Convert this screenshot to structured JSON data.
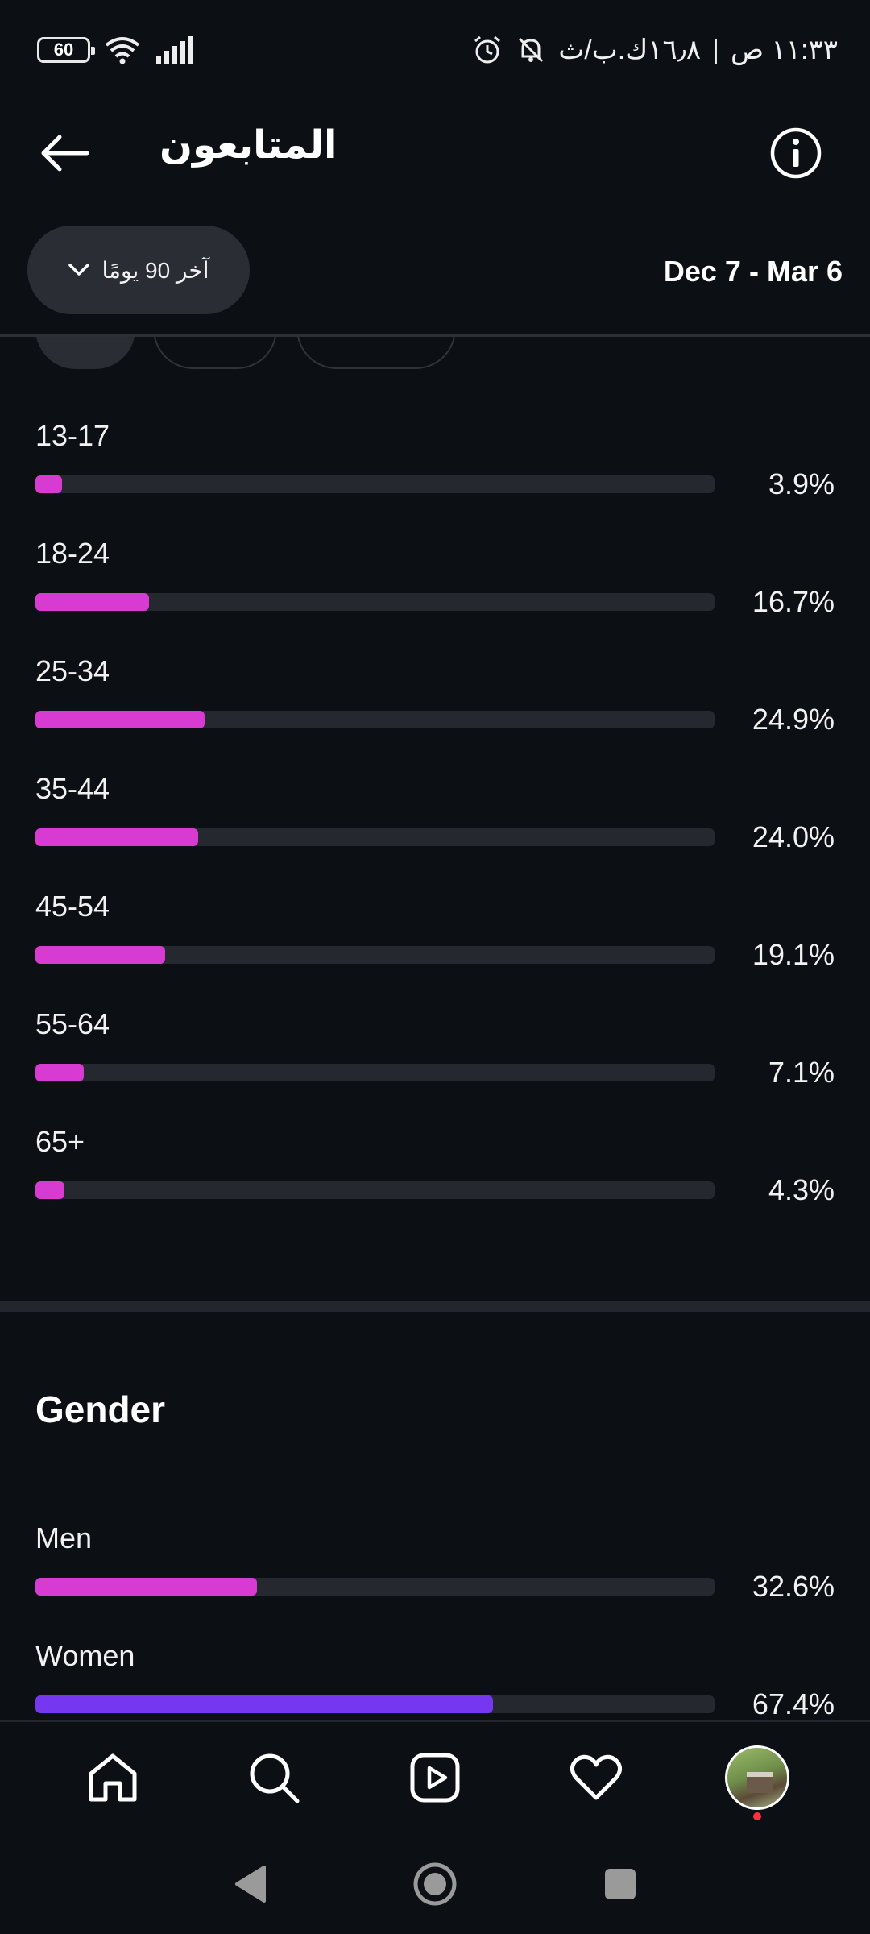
{
  "status_bar": {
    "battery_level": "60",
    "time": "١١:٣٣ ص",
    "network_speed": "١٦٫٨ك.ب/ث"
  },
  "header": {
    "title": "المتابعون",
    "back_icon": "arrow-left-icon",
    "info_icon": "info-icon"
  },
  "filter": {
    "range_label": "آخر 90 يومًا",
    "date_range": "Dec 7 - Mar 6"
  },
  "age_ranges": [
    {
      "label": "13-17",
      "value": "3.9%",
      "percent": 3.9
    },
    {
      "label": "18-24",
      "value": "16.7%",
      "percent": 16.7
    },
    {
      "label": "25-34",
      "value": "24.9%",
      "percent": 24.9
    },
    {
      "label": "35-44",
      "value": "24.0%",
      "percent": 24.0
    },
    {
      "label": "45-54",
      "value": "19.1%",
      "percent": 19.1
    },
    {
      "label": "55-64",
      "value": "7.1%",
      "percent": 7.1
    },
    {
      "label": "65+",
      "value": "4.3%",
      "percent": 4.3
    }
  ],
  "gender": {
    "title": "Gender",
    "items": [
      {
        "label": "Men",
        "value": "32.6%",
        "percent": 32.6
      },
      {
        "label": "Women",
        "value": "67.4%",
        "percent": 67.4
      }
    ]
  },
  "colors": {
    "background": "#0c0f14",
    "bar_track": "#25282e",
    "bar_pink": "#d83bd2",
    "bar_purple": "#7637f0",
    "notification_dot": "#ff3040"
  },
  "bottom_nav": [
    "home-icon",
    "search-icon",
    "reels-icon",
    "heart-icon",
    "profile-avatar"
  ],
  "system_nav": [
    "back-triangle-icon",
    "home-circle-icon",
    "recents-square-icon"
  ]
}
